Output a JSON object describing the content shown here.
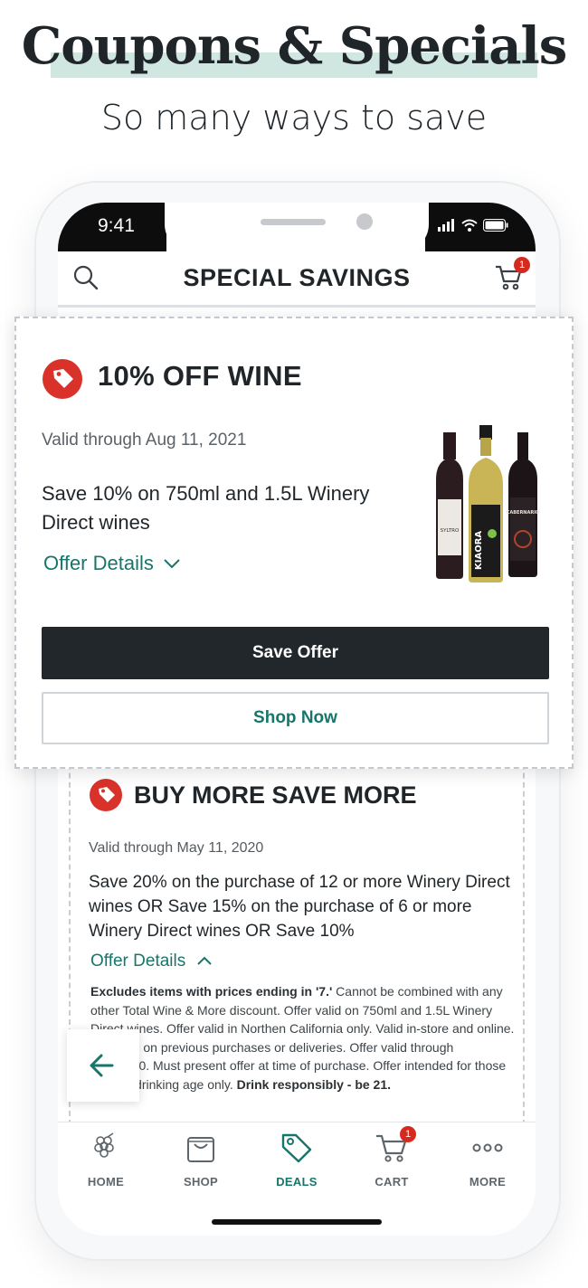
{
  "hero": {
    "title": "Coupons & Specials",
    "subtitle": "So many ways to save"
  },
  "status_bar": {
    "time": "9:41"
  },
  "app_bar": {
    "title": "SPECIAL SAVINGS",
    "cart_count": "1"
  },
  "featured_offer": {
    "title": "10% OFF WINE",
    "valid": "Valid through Aug 11, 2021",
    "description": "Save 10% on 750ml and 1.5L Winery Direct wines",
    "details_label": "Offer Details",
    "save_button": "Save Offer",
    "shop_button": "Shop Now",
    "bottle_labels": [
      "SYLTRO",
      "KIAORA",
      "CABERNARIO"
    ]
  },
  "second_offer": {
    "title": "BUY MORE SAVE MORE",
    "valid": "Valid through May 11, 2020",
    "description": "Save 20% on the purchase of 12 or more Winery Direct wines OR Save 15% on the purchase of 6 or more Winery Direct wines OR Save 10%",
    "details_label": "Offer Details",
    "fine_print_bold_1": "Excludes items with prices ending in '7.'",
    "fine_print_1": " Cannot be combined with any other Total Wine & More discount. Offer valid on 750ml and 1.5L Winery Direct wines. Offer valid in Northen California only. Valid in-store and online. Not valid on previous purchases or deliveries. Offer valid through 5/11/2020. Must present offer at time of purchase. Offer intended for those of legal drinking age only. ",
    "fine_print_bold_2": "Drink responsibly - be 21."
  },
  "tabs": [
    {
      "label": "HOME",
      "icon": "grapes-icon"
    },
    {
      "label": "SHOP",
      "icon": "shopping-bag-icon"
    },
    {
      "label": "DEALS",
      "icon": "tag-icon"
    },
    {
      "label": "CART",
      "icon": "cart-icon",
      "badge": "1"
    },
    {
      "label": "MORE",
      "icon": "more-dots-icon"
    }
  ],
  "colors": {
    "accent": "#17766a",
    "dark": "#22272b",
    "badge": "#d52b1e",
    "tag_red": "#d9322a"
  }
}
